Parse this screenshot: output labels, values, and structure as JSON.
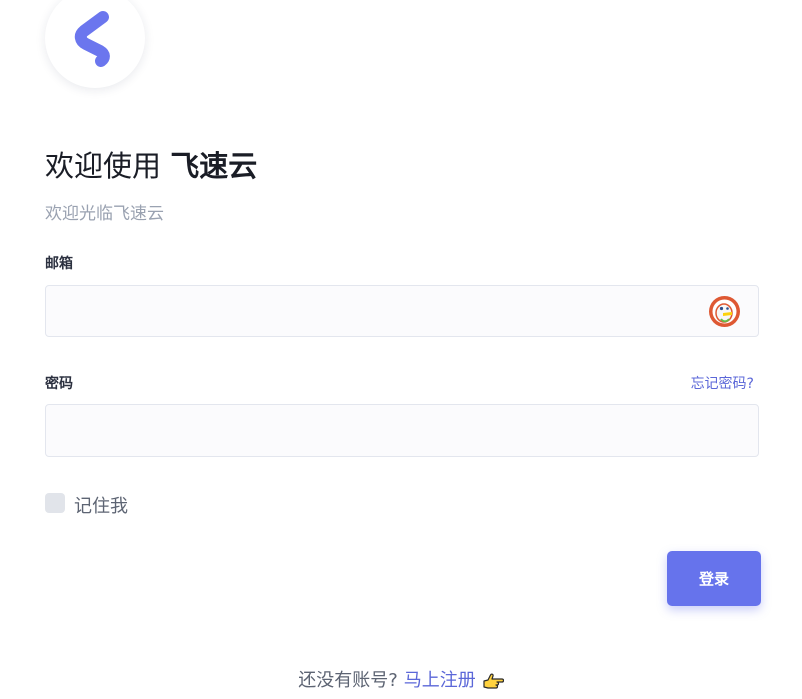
{
  "colors": {
    "accent": "#6673ec",
    "logo": "#6b76ee"
  },
  "header": {
    "logo_icon": "s-logo-icon",
    "title_prefix": "欢迎使用",
    "title_brand": "飞速云",
    "subtitle": "欢迎光临飞速云"
  },
  "form": {
    "email_label": "邮箱",
    "email_value": "",
    "password_label": "密码",
    "password_value": "",
    "forgot_link": "忘记密码?",
    "remember_label": "记住我",
    "remember_checked": false,
    "submit_label": "登录",
    "autofill_icon": "duckduckgo-icon"
  },
  "footer": {
    "prompt": "还没有账号?",
    "signup_link": "马上注册",
    "pointer_icon": "pointing-hand-icon"
  }
}
